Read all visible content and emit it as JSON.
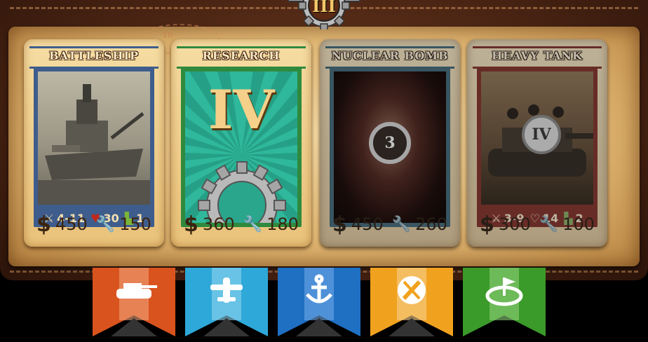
{
  "era_badge": {
    "numeral": "III",
    "icon": "gear-badge"
  },
  "map_doodle": {
    "label": "10"
  },
  "cards": [
    {
      "title": "BATTLESHIP",
      "kind": "unit",
      "band_color": "#3e5d8c",
      "art": "battleship-photo",
      "stats": {
        "attack": "4-11",
        "health": "30",
        "move": "1"
      },
      "cost": {
        "money": "450",
        "tools": "150"
      },
      "enabled": true
    },
    {
      "title": "RESEARCH",
      "kind": "research",
      "band_color": "#2f8a3e",
      "art": "research-roman-numeral",
      "numeral": "IV",
      "cost": {
        "money": "360",
        "tools": "180"
      },
      "enabled": true
    },
    {
      "title": "NUCLEAR BOMB",
      "kind": "weapon",
      "band_color": "#2f6f8c",
      "art": "nuclear-explosion",
      "badge_number": "3",
      "cost": {
        "money": "450",
        "tools": "260"
      },
      "enabled": false
    },
    {
      "title": "HEAVY TANK",
      "kind": "unit",
      "band_color": "#b32a1e",
      "art": "heavy-tank-photo",
      "level_numeral": "IV",
      "stats": {
        "attack": "3-9",
        "health": "14",
        "move": "2"
      },
      "cost": {
        "money": "300",
        "tools": "100"
      },
      "enabled": false
    }
  ],
  "tabs": [
    {
      "name": "tank",
      "icon": "tank-icon",
      "color": "#d9531e",
      "stripe": "#f0a27a"
    },
    {
      "name": "air",
      "icon": "plane-icon",
      "color": "#2ea8d8",
      "stripe": "#8fd6f0"
    },
    {
      "name": "navy",
      "icon": "anchor-icon",
      "color": "#1f6fc2",
      "stripe": "#6fa9e6"
    },
    {
      "name": "upgrade",
      "icon": "wrench-icon",
      "color": "#f0a21e",
      "stripe": "#f6cf8a"
    },
    {
      "name": "capture",
      "icon": "flag-icon",
      "color": "#3a9a2a",
      "stripe": "#8fd07a"
    }
  ]
}
